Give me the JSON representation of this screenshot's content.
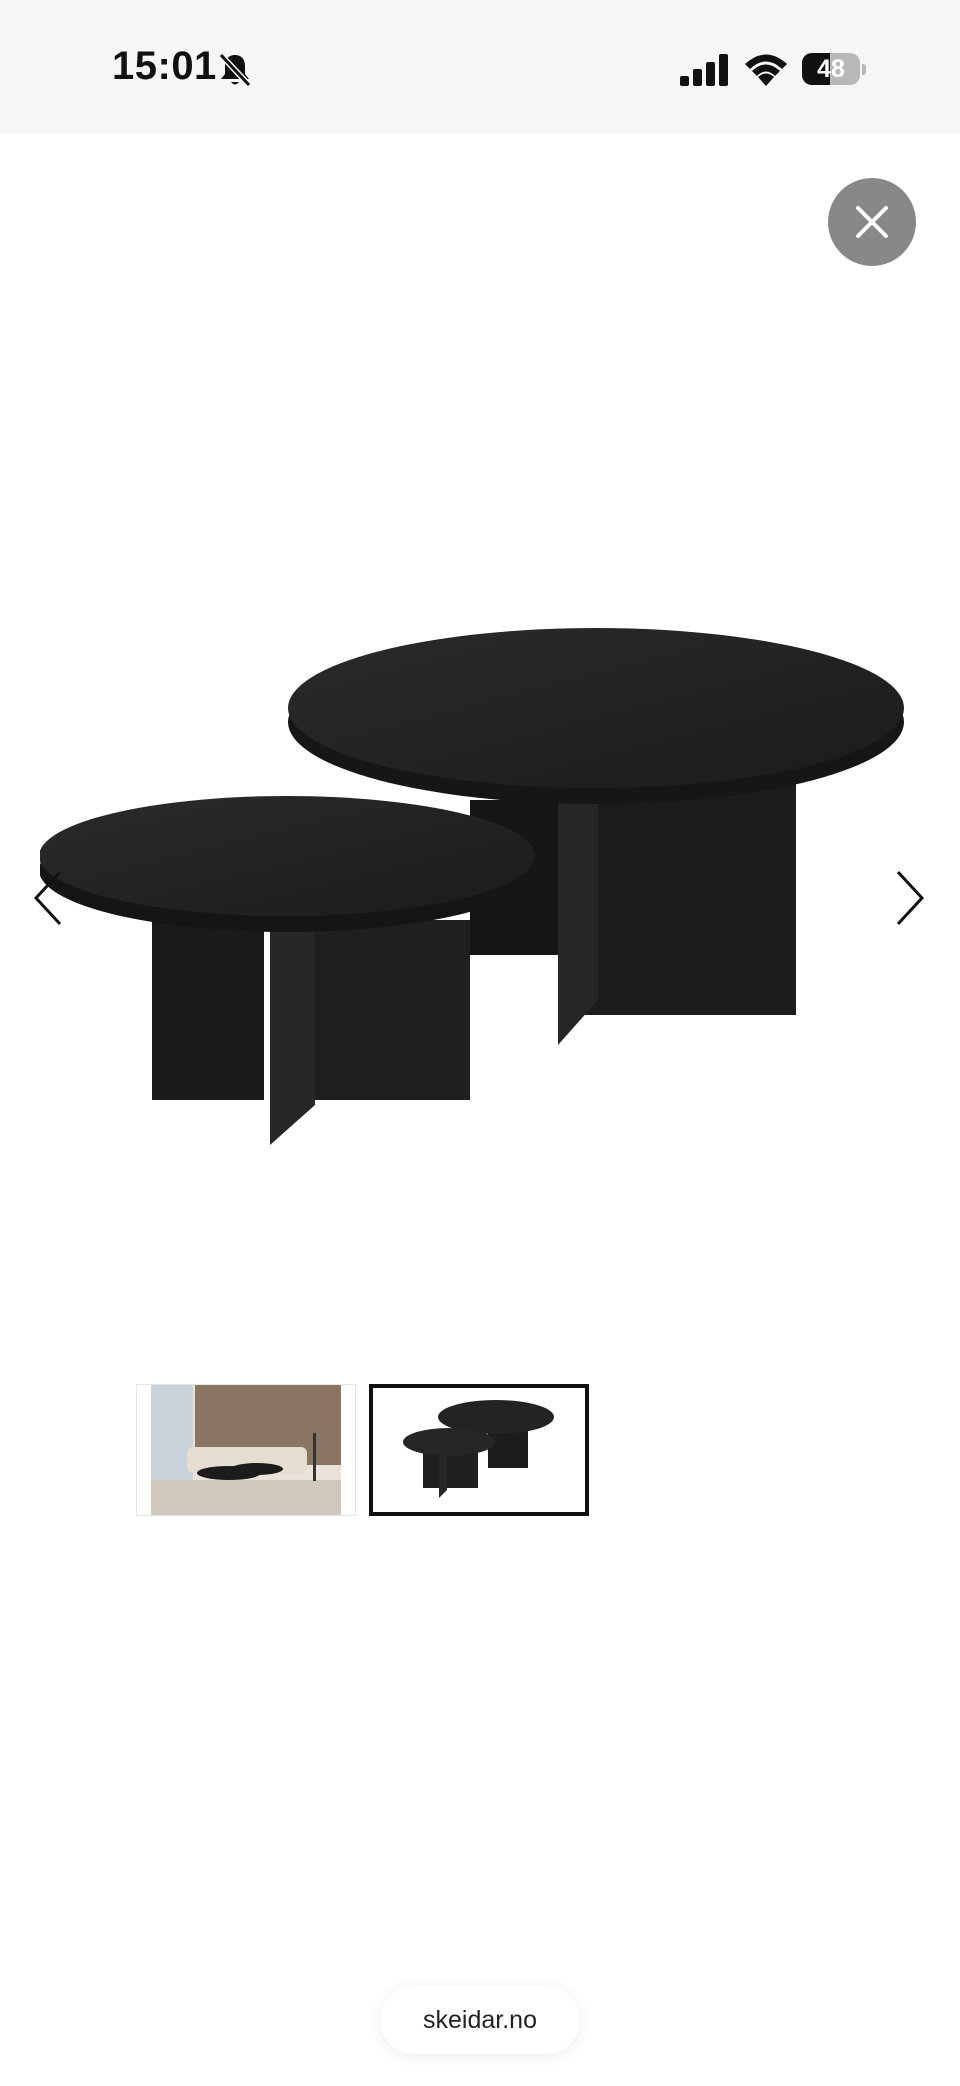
{
  "status_bar": {
    "time": "15:01",
    "battery_level": "48",
    "battery_fraction": 0.48,
    "icons": [
      "bell-slash-icon",
      "cellular-signal-icon",
      "wifi-icon",
      "battery-icon"
    ]
  },
  "viewer": {
    "close_icon": "close-icon",
    "prev_icon": "chevron-left-icon",
    "next_icon": "chevron-right-icon",
    "thumbnails_count": 2,
    "selected_thumbnail": 2
  },
  "browser": {
    "domain": "skeidar.no"
  },
  "colors": {
    "status_bar_bg": "#f6f6f6",
    "close_button_bg": "#888888",
    "table_color": "#1c1d1c",
    "selected_border": "#111111"
  }
}
